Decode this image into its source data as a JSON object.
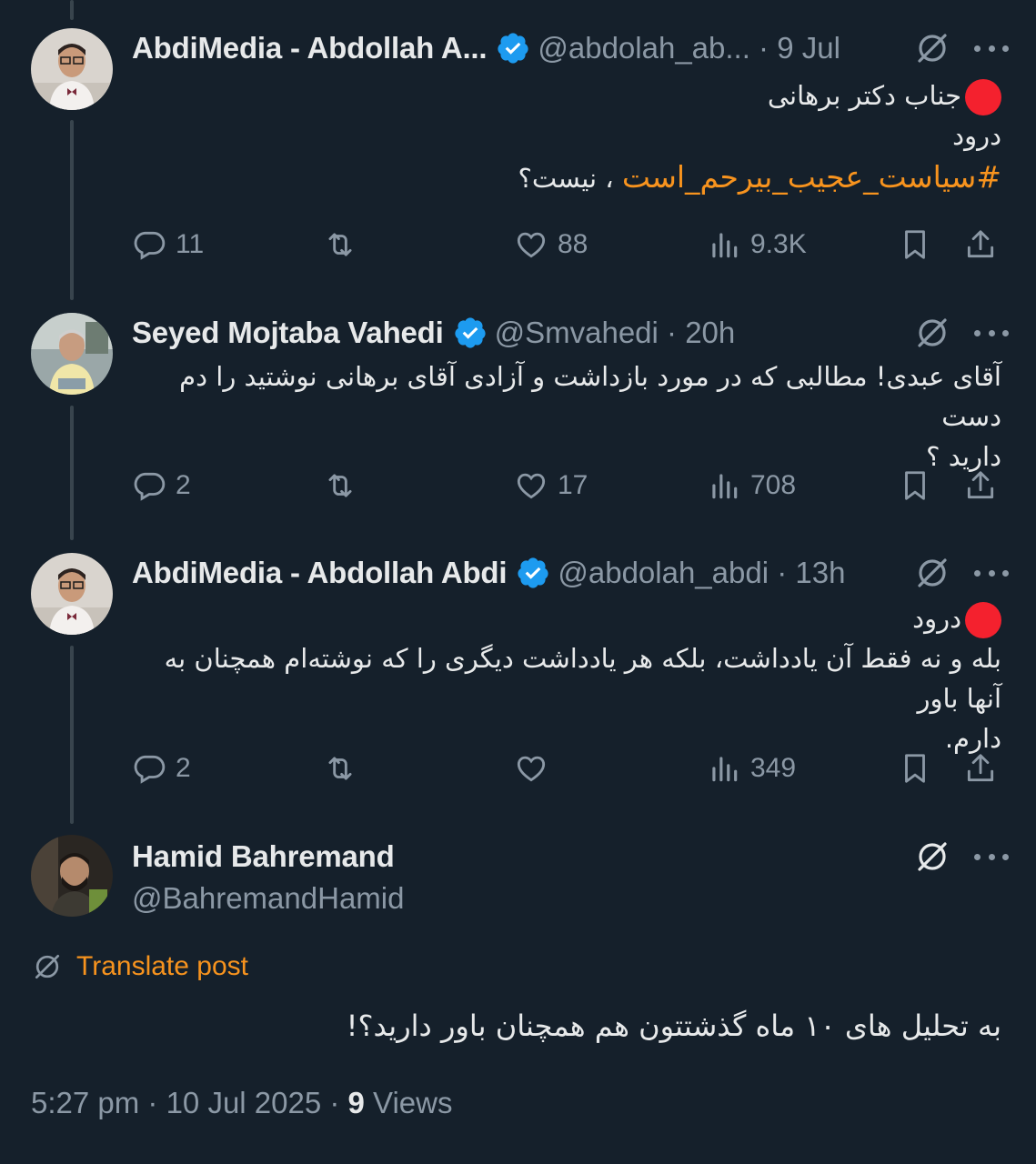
{
  "colors": {
    "background": "#15202b",
    "text": "#e7e9ea",
    "muted": "#8b98a5",
    "accent": "#f7931e",
    "verified": "#1d9bf0",
    "red_dot": "#f4212e"
  },
  "tweets": [
    {
      "name": "AbdiMedia - Abdollah A...",
      "handle": "@abdolah_ab...",
      "time": "9 Jul",
      "verified": true,
      "lines": [
        "جناب دکتر برهانی",
        "درود"
      ],
      "hashtag": "#سیاست_عجیب_بیرحم_است",
      "hashtag_suffix": " ، نیست؟",
      "replies": "11",
      "retweets": "",
      "likes": "88",
      "views": "9.3K"
    },
    {
      "name": "Seyed Mojtaba Vahedi",
      "handle": "@Smvahedi",
      "time": "20h",
      "verified": true,
      "lines": [
        "آقای عبدی! مطالبی  که در مورد بازداشت و آزادی آقای  برهانی  نوشتید را دم دست",
        "دارید ؟"
      ],
      "replies": "2",
      "retweets": "",
      "likes": "17",
      "views": "708"
    },
    {
      "name": "AbdiMedia - Abdollah Abdi",
      "handle": "@abdolah_abdi",
      "time": "13h",
      "verified": true,
      "lines": [
        "درود",
        "بله و نه فقط آن یادداشت، بلکه هر یادداشت دیگری را که نوشته‌ام همچنان به آنها باور",
        "دارم."
      ],
      "replies": "2",
      "retweets": "",
      "likes": "",
      "views": "349"
    }
  ],
  "main": {
    "name": "Hamid Bahremand",
    "handle": "@BahremandHamid",
    "translate": "Translate post",
    "text": "به تحلیل های ۱۰ ماه گذشتتون هم همچنان باور دارید؟!",
    "timestamp": "5:27 pm · 10 Jul 2025 · ",
    "views_count": "9",
    "views_label": " Views"
  },
  "icons": [
    "verified-badge-icon",
    "grok-icon",
    "more-icon",
    "reply-icon",
    "retweet-icon",
    "like-icon",
    "views-icon",
    "bookmark-icon",
    "share-icon"
  ]
}
